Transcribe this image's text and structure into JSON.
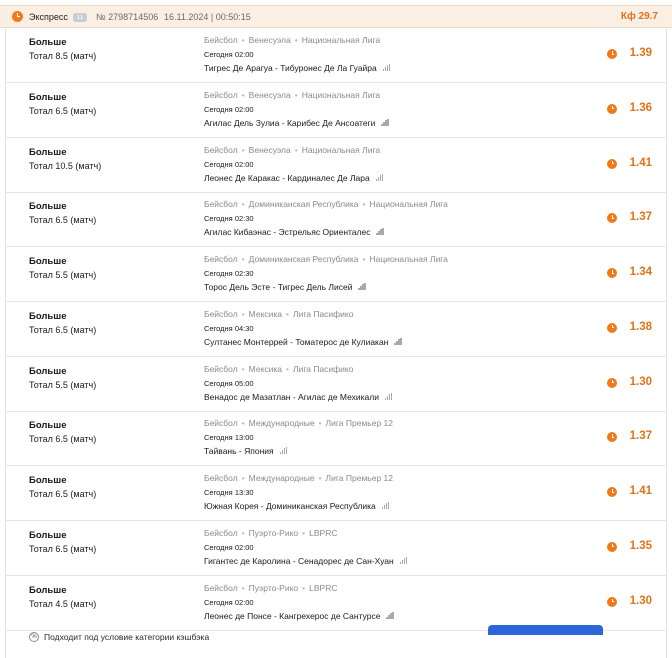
{
  "header": {
    "bet_type": "Экспресс",
    "count_badge": "11",
    "bet_number": "№ 2798714506",
    "date": "16.11.2024 | 00:50:15",
    "total_coef": "Кф 29.7",
    "accent_color": "#f07a1a",
    "status_icon": "clock-icon"
  },
  "events": [
    {
      "outcome": "Больше",
      "market": "Тотал 8.5 (матч)",
      "sport": "Бейсбол",
      "country": "Венесуэла",
      "league": "Национальная Лига",
      "time": "Сегодня 02:00",
      "match": "Тигрес Де Арагуа - Тибуронес Де Ла Гуайра",
      "odds": "1.39"
    },
    {
      "outcome": "Больше",
      "market": "Тотал 6.5 (матч)",
      "sport": "Бейсбол",
      "country": "Венесуэла",
      "league": "Национальная Лига",
      "time": "Сегодня 02:00",
      "match": "Агилас Дель Зулиа - Карибес Де Ансоатеги",
      "odds": "1.36"
    },
    {
      "outcome": "Больше",
      "market": "Тотал 10.5 (матч)",
      "sport": "Бейсбол",
      "country": "Венесуэла",
      "league": "Национальная Лига",
      "time": "Сегодня 02:00",
      "match": "Леонес Де Каракас - Кардиналес Де Лара",
      "odds": "1.41"
    },
    {
      "outcome": "Больше",
      "market": "Тотал 6.5 (матч)",
      "sport": "Бейсбол",
      "country": "Доминиканская Республика",
      "league": "Национальная Лига",
      "time": "Сегодня 02:30",
      "match": "Агилас Кибаэнас - Эстрельяс Ориенталес",
      "odds": "1.37"
    },
    {
      "outcome": "Больше",
      "market": "Тотал 5.5 (матч)",
      "sport": "Бейсбол",
      "country": "Доминиканская Республика",
      "league": "Национальная Лига",
      "time": "Сегодня 02:30",
      "match": "Торос Дель Эсте - Тигрес Дель Лисей",
      "odds": "1.34"
    },
    {
      "outcome": "Больше",
      "market": "Тотал 6.5 (матч)",
      "sport": "Бейсбол",
      "country": "Мексика",
      "league": "Лига Пасифико",
      "time": "Сегодня 04:30",
      "match": "Султанес Монтеррей - Томатерос де Кулиакан",
      "odds": "1.38"
    },
    {
      "outcome": "Больше",
      "market": "Тотал 5.5 (матч)",
      "sport": "Бейсбол",
      "country": "Мексика",
      "league": "Лига Пасифико",
      "time": "Сегодня 05:00",
      "match": "Венадос де Мазатлан - Агилас де Мехикали",
      "odds": "1.30"
    },
    {
      "outcome": "Больше",
      "market": "Тотал 6.5 (матч)",
      "sport": "Бейсбол",
      "country": "Международные",
      "league": "Лига Премьер 12",
      "time": "Сегодня 13:00",
      "match": "Тайвань - Япония",
      "odds": "1.37"
    },
    {
      "outcome": "Больше",
      "market": "Тотал 6.5 (матч)",
      "sport": "Бейсбол",
      "country": "Международные",
      "league": "Лига Премьер 12",
      "time": "Сегодня 13:30",
      "match": "Южная Корея - Доминиканская Республика",
      "odds": "1.41"
    },
    {
      "outcome": "Больше",
      "market": "Тотал 6.5 (матч)",
      "sport": "Бейсбол",
      "country": "Пуэрто-Рико",
      "league": "LBPRC",
      "time": "Сегодня 02:00",
      "match": "Гигантес де Каролина - Сенадорес де Сан-Хуан",
      "odds": "1.35"
    },
    {
      "outcome": "Больше",
      "market": "Тотал 4.5 (матч)",
      "sport": "Бейсбол",
      "country": "Пуэрто-Рико",
      "league": "LBPRC",
      "time": "Сегодня 02:00",
      "match": "Леонес де Понсе - Кангрехерос де Сантурсе",
      "odds": "1.30"
    }
  ],
  "footer": {
    "cashback_icon": "%",
    "cashback_text": "Подходит под условие категории кэшбэка"
  }
}
